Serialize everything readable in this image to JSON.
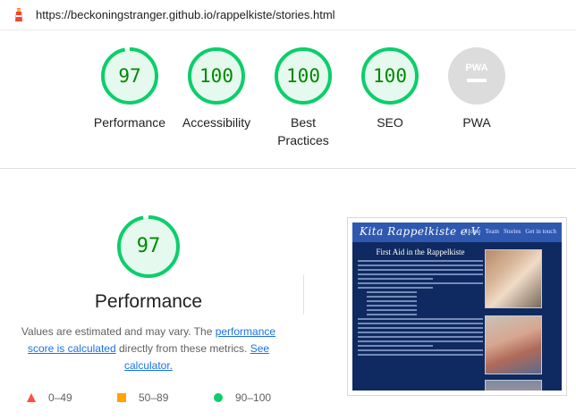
{
  "urlbar": {
    "url": "https://beckoningstranger.github.io/rappelkiste/stories.html",
    "logo_icon": "lighthouse-icon"
  },
  "gauges": [
    {
      "score": "97",
      "label": "Performance",
      "color": "#0cce6b",
      "fraction": 0.97
    },
    {
      "score": "100",
      "label": "Accessibility",
      "color": "#0cce6b",
      "fraction": 1.0
    },
    {
      "score": "100",
      "label": "Best Practices",
      "color": "#0cce6b",
      "fraction": 1.0
    },
    {
      "score": "100",
      "label": "SEO",
      "color": "#0cce6b",
      "fraction": 1.0
    },
    {
      "score": "PWA",
      "label": "PWA",
      "color": "#cccccc",
      "fraction": 0
    }
  ],
  "performance": {
    "score": "97",
    "title": "Performance",
    "desc_prefix": "Values are estimated and may vary. The ",
    "desc_link1": "performance score is calculated",
    "desc_middle": " directly from these metrics. ",
    "desc_link2": "See calculator."
  },
  "legend": [
    {
      "range": "0–49",
      "shape": "triangle",
      "color": "#ff4e42"
    },
    {
      "range": "50–89",
      "shape": "square",
      "color": "#ffa400"
    },
    {
      "range": "90–100",
      "shape": "circle",
      "color": "#0cce6b"
    }
  ],
  "thumbnail": {
    "brand": "Kita Rappelkiste e.V.",
    "nav": [
      "Home",
      "Team",
      "Stories",
      "Get in touch"
    ],
    "article_title": "First Aid in the Rappelkiste"
  }
}
